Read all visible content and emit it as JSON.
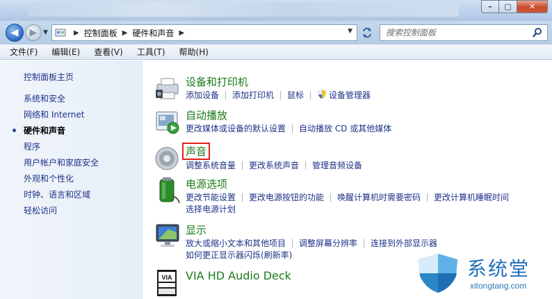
{
  "window": {
    "min_glyph": "–",
    "max_glyph": "▢",
    "close_glyph": "✕"
  },
  "nav": {
    "back_glyph": "◀",
    "forward_glyph": "▶",
    "breadcrumb": [
      "控制面板",
      "硬件和声音"
    ],
    "crumb_sep": "▶",
    "search_placeholder": "搜索控制面板"
  },
  "menu": [
    "文件(F)",
    "编辑(E)",
    "查看(V)",
    "工具(T)",
    "帮助(H)"
  ],
  "sidebar": {
    "home": "控制面板主页",
    "items": [
      {
        "label": "系统和安全"
      },
      {
        "label": "网络和 Internet"
      },
      {
        "label": "硬件和声音",
        "active": true
      },
      {
        "label": "程序"
      },
      {
        "label": "用户帐户和家庭安全"
      },
      {
        "label": "外观和个性化"
      },
      {
        "label": "时钟、语言和区域"
      },
      {
        "label": "轻松访问"
      }
    ]
  },
  "categories": [
    {
      "id": "devices",
      "icon": "printer-icon",
      "title": "设备和打印机",
      "links": [
        "添加设备",
        "添加打印机",
        "鼠标",
        "设备管理器"
      ],
      "shield_on": "设备管理器"
    },
    {
      "id": "autoplay",
      "icon": "autoplay-icon",
      "title": "自动播放",
      "links": [
        "更改媒体或设备的默认设置",
        "自动播放 CD 或其他媒体"
      ]
    },
    {
      "id": "sound",
      "icon": "speaker-icon",
      "title": "声音",
      "highlighted": true,
      "links": [
        "调整系统音量",
        "更改系统声音",
        "管理音频设备"
      ]
    },
    {
      "id": "power",
      "icon": "battery-icon",
      "title": "电源选项",
      "links": [
        "更改节能设置",
        "更改电源按钮的功能",
        "唤醒计算机时需要密码",
        "更改计算机睡眠时间"
      ],
      "links2": "选择电源计划"
    },
    {
      "id": "display",
      "icon": "monitor-icon",
      "title": "显示",
      "links": [
        "放大或缩小文本和其他项目",
        "调整屏幕分辨率",
        "连接到外部显示器"
      ],
      "links2": "如何更正显示器闪烁(刷新率)"
    },
    {
      "id": "via",
      "icon": "via-audio-icon",
      "title": "VIA HD Audio Deck",
      "links": []
    }
  ],
  "watermark": {
    "text": "系统堂",
    "url": "xitongtang.com"
  },
  "colors": {
    "link": "#1e3287",
    "category_title": "#1a7a1a",
    "highlight_box": "#e0201a"
  }
}
